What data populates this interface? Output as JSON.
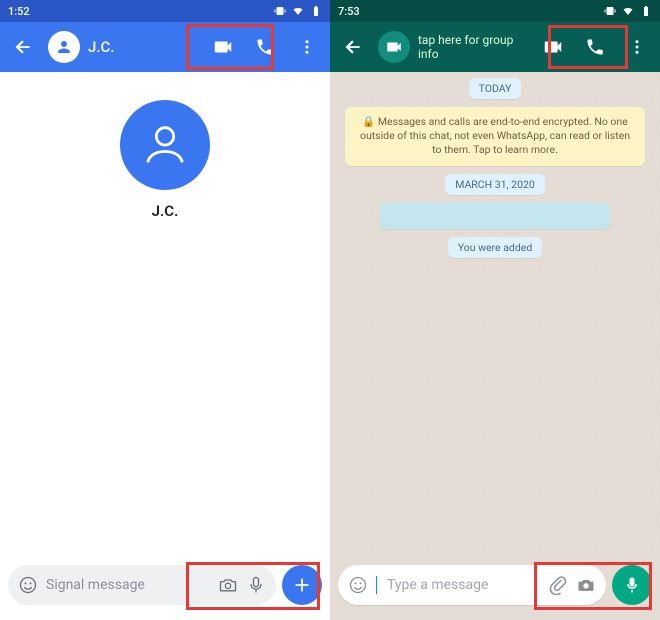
{
  "left": {
    "status_time": "1:52",
    "contact_name": "J.C.",
    "big_name": "J.C.",
    "input_placeholder": "Signal message"
  },
  "right": {
    "status_time": "7:53",
    "header_subtitle": "tap here for group info",
    "today_label": "TODAY",
    "encryption_notice": "🔒 Messages and calls are end-to-end encrypted. No one outside of this chat, not even WhatsApp, can read or listen to them. Tap to learn more.",
    "date_label": "MARCH 31, 2020",
    "added_label": "You were added",
    "input_placeholder": "Type a message"
  }
}
